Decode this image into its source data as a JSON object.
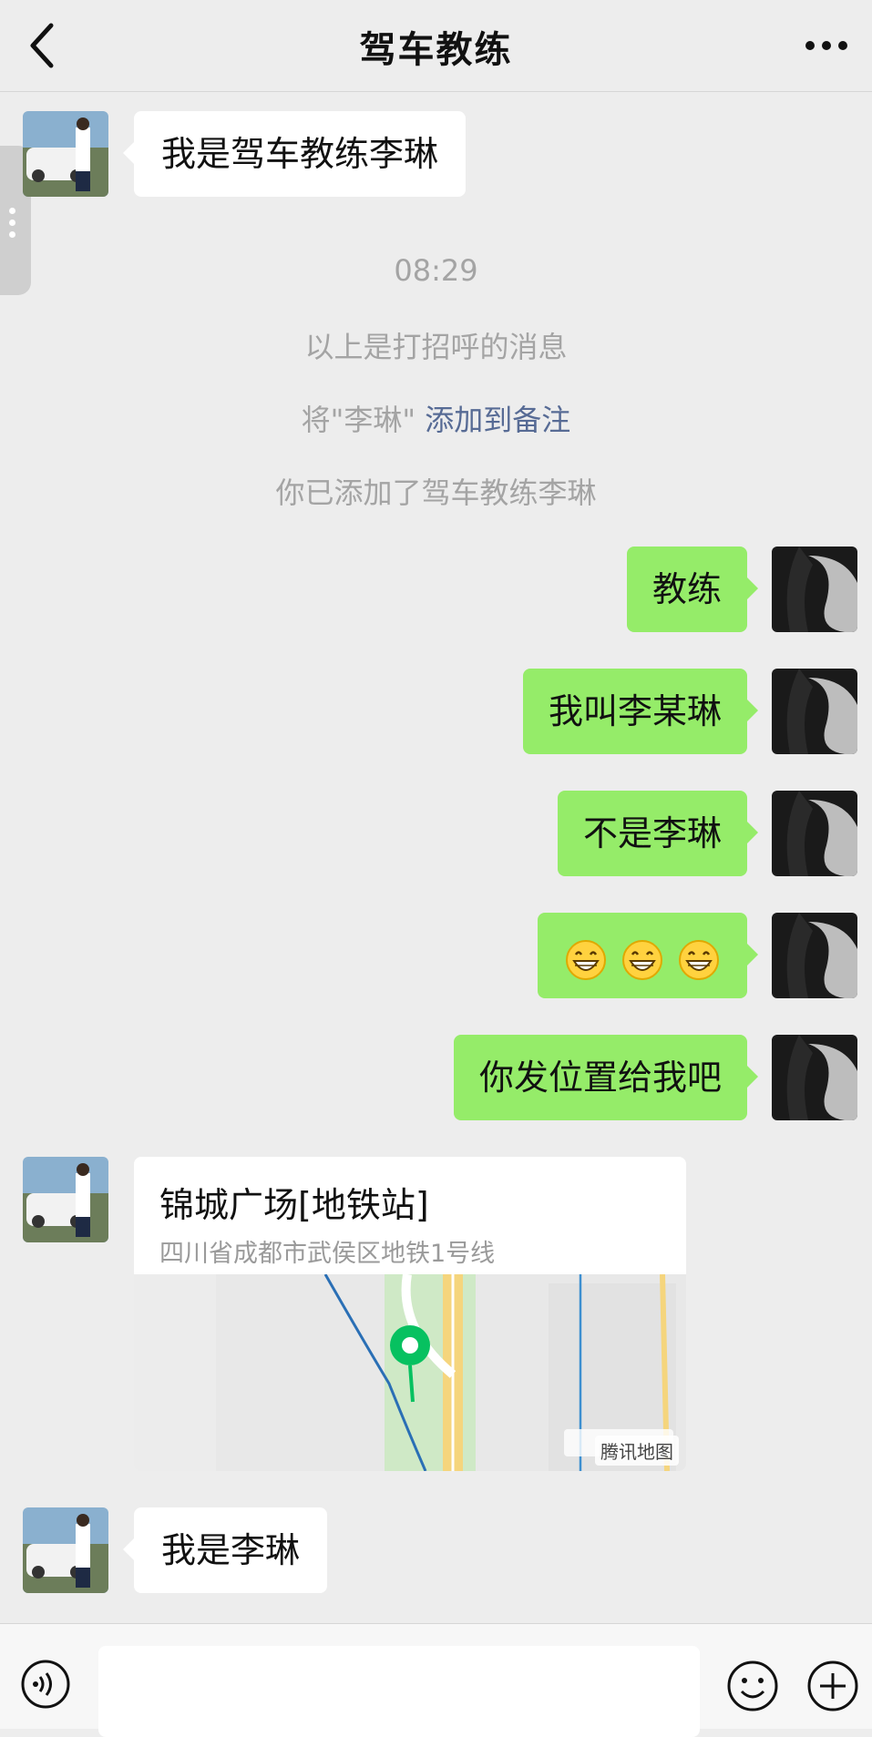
{
  "header": {
    "title": "驾车教练"
  },
  "messages": {
    "coach_intro": "我是驾车教练李琳",
    "me_1": "教练",
    "me_2": "我叫李某琳",
    "me_3": "不是李琳",
    "me_5": "你发位置给我吧",
    "coach_last": "我是李琳"
  },
  "system": {
    "time": "08:29",
    "greeting": "以上是打招呼的消息",
    "remark_prefix": "将\"李琳\"",
    "remark_link": "添加到备注",
    "added": "你已添加了驾车教练李琳"
  },
  "location": {
    "title": "锦城广场[地铁站]",
    "address": "四川省成都市武侯区地铁1号线",
    "map_provider": "腾讯地图"
  },
  "emoji_count": 3,
  "colors": {
    "my_bubble": "#95ec69",
    "link": "#576b95",
    "pin": "#07c160"
  }
}
